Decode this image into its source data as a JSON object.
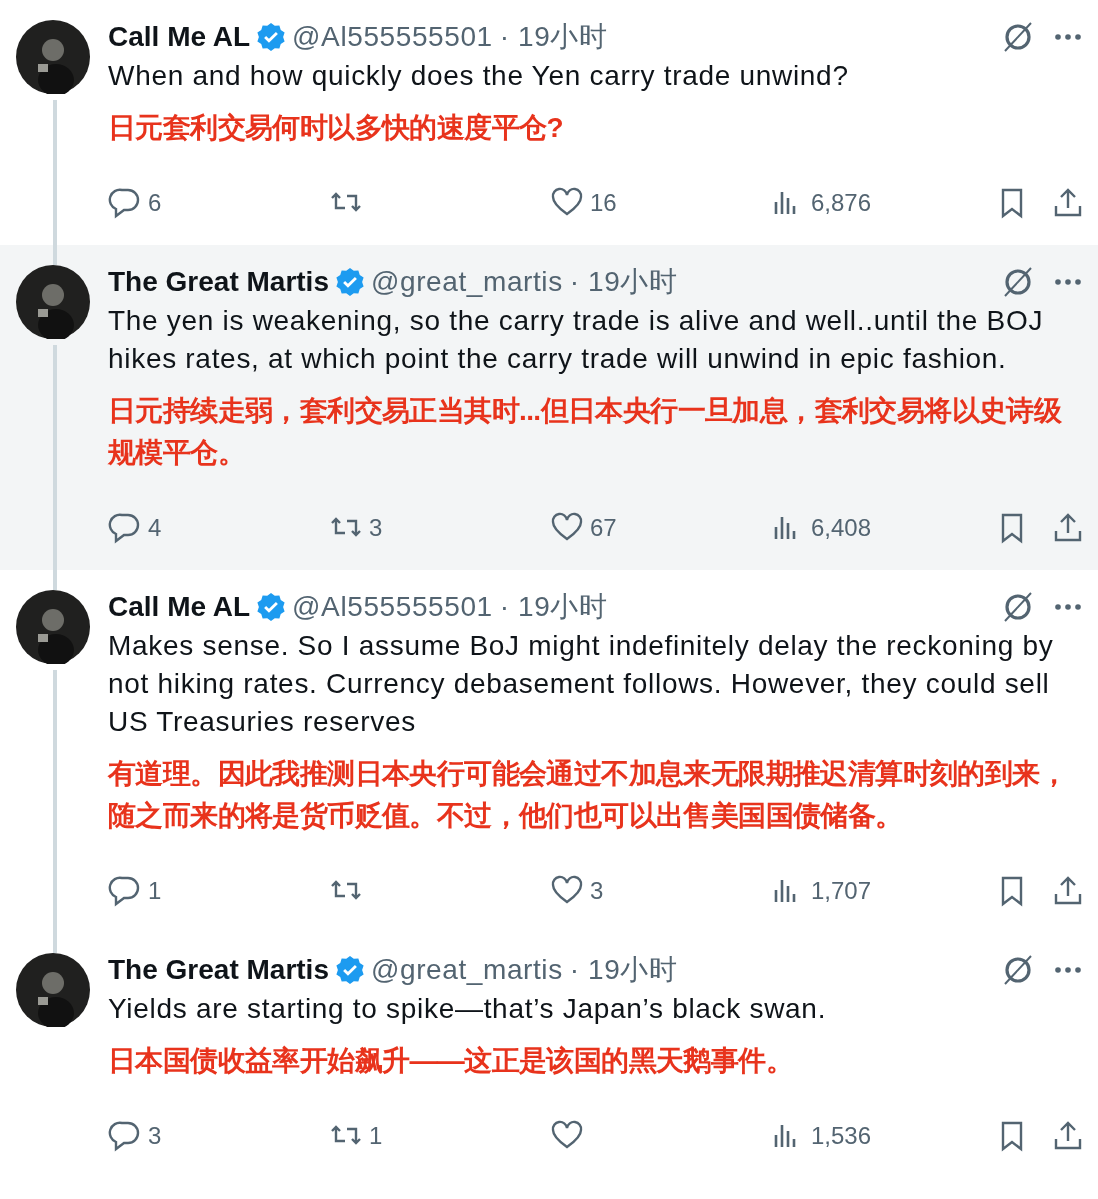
{
  "tweets": [
    {
      "name": "Call Me AL",
      "verified": true,
      "handle": "@Al555555501",
      "time": "· 19小时",
      "highlighted": false,
      "thread_above": false,
      "thread_below": true,
      "text": "When and how quickly does the Yen carry trade unwind?",
      "translation": "日元套利交易何时以多快的速度平仓?",
      "replies": "6",
      "likes": "16",
      "views": "6,876"
    },
    {
      "name": "The Great Martis",
      "verified": true,
      "handle": "@great_martis",
      "time": "· 19小时",
      "highlighted": true,
      "thread_above": true,
      "thread_below": true,
      "text": "The yen is weakening, so the carry trade is alive and well..until the BOJ hikes rates, at which point the carry trade will unwind in epic fashion.",
      "translation": "日元持续走弱，套利交易正当其时...但日本央行一旦加息，套利交易将以史诗级规模平仓。",
      "replies": "4",
      "reposts": "3",
      "likes": "67",
      "views": "6,408"
    },
    {
      "name": "Call Me AL",
      "verified": true,
      "handle": "@Al555555501",
      "time": "· 19小时",
      "highlighted": false,
      "thread_above": true,
      "thread_below": true,
      "text": "Makes sense. So I assume BoJ might indefinitely delay the reckoning by not hiking rates.  Currency debasement follows.  However, they could sell US Treasuries reserves",
      "translation": "有道理。因此我推测日本央行可能会通过不加息来无限期推迟清算时刻的到来，随之而来的将是货币贬值。不过，他们也可以出售美国国债储备。",
      "replies": "1",
      "likes": "3",
      "views": "1,707"
    },
    {
      "name": "The Great Martis",
      "verified": true,
      "handle": "@great_martis",
      "time": "· 19小时",
      "highlighted": false,
      "thread_above": true,
      "thread_below": false,
      "text": "Yields are starting to spike—that’s Japan’s black swan.",
      "translation": "日本国债收益率开始飙升——这正是该国的黑天鹅事件。",
      "replies": "3",
      "reposts": "1",
      "views": "1,536"
    }
  ]
}
